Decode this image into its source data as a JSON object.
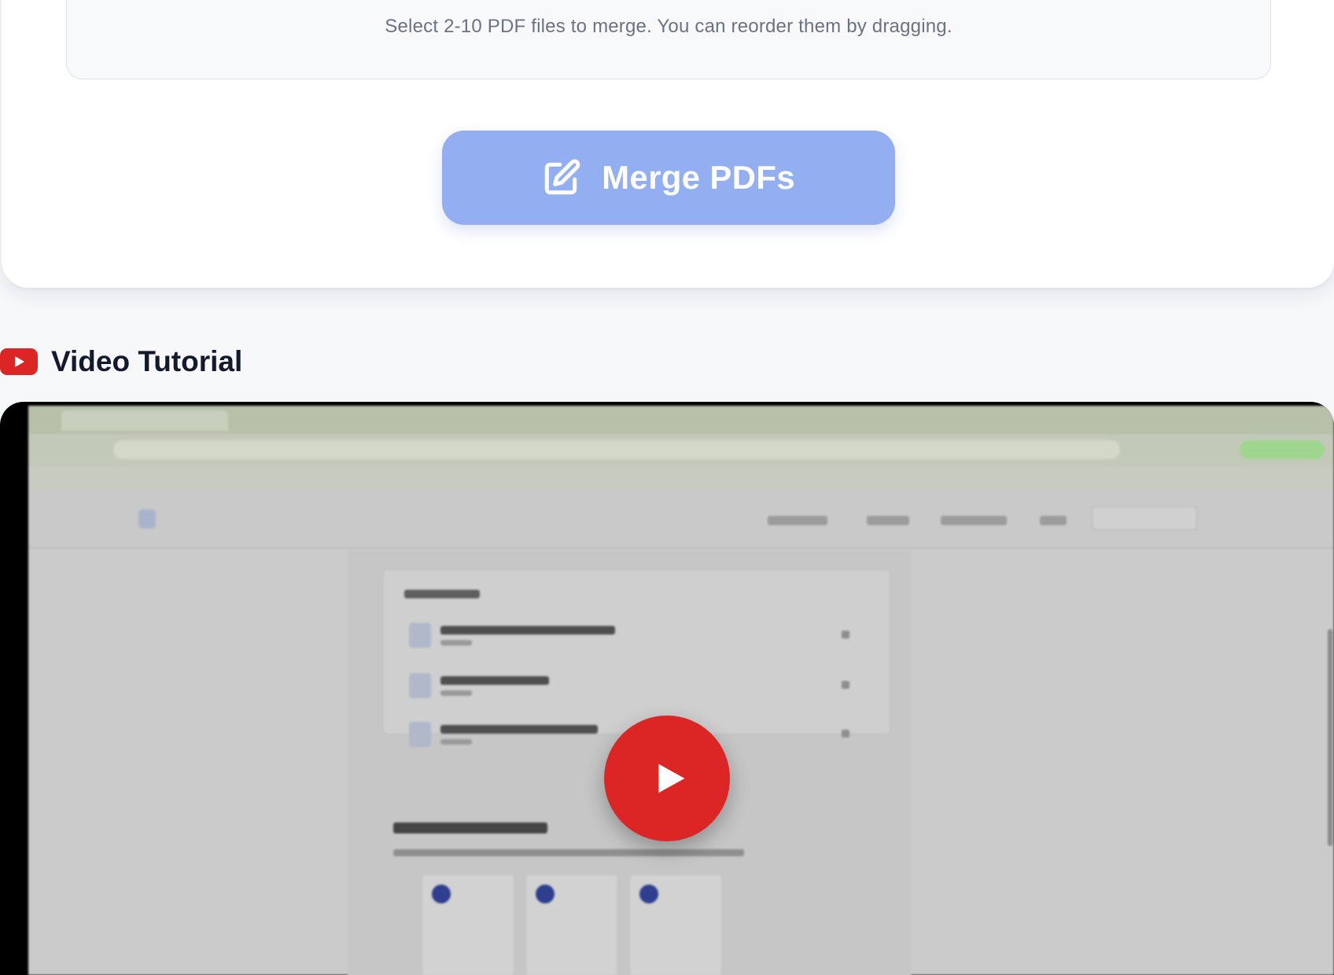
{
  "upload": {
    "hint": "Select 2-10 PDF files to merge. You can reorder them by dragging."
  },
  "merge_button": {
    "label": "Merge PDFs",
    "icon": "edit-icon",
    "background": "#93aff2"
  },
  "tutorial": {
    "title": "Video Tutorial",
    "icon": "youtube-icon",
    "play_icon": "play-icon",
    "accent": "#dc2626"
  }
}
